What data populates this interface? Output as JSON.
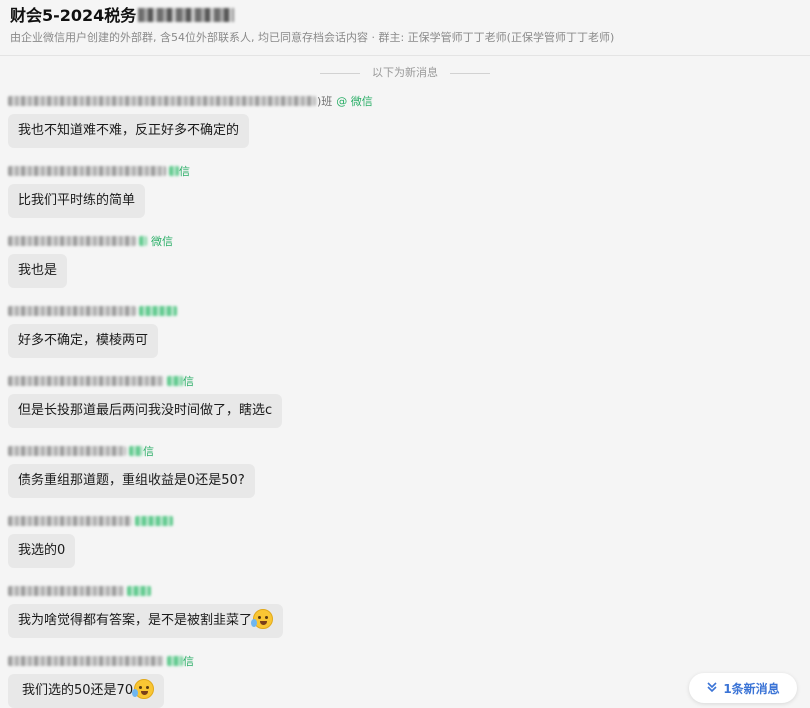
{
  "header": {
    "title": "财会5-2024税务",
    "subtitle": "由企业微信用户创建的外部群, 含54位外部联系人, 均已同意存档会话内容  · 群主: 正保学管师丁丁老师(正保学管师丁丁老师)"
  },
  "divider": {
    "label": "以下为新消息"
  },
  "messages": [
    {
      "sender_suffix": ")班",
      "at_source": "@ 微信",
      "text": "我也不知道难不难，反正好多不确定的"
    },
    {
      "sender_suffix": "",
      "at_source": "信",
      "text": "比我们平时练的简单"
    },
    {
      "sender_suffix": "",
      "at_source": "微信",
      "text": "我也是"
    },
    {
      "sender_suffix": "",
      "at_source": "",
      "text": "好多不确定，模棱两可"
    },
    {
      "sender_suffix": "",
      "at_source": "信",
      "text": "但是长投那道最后两问我没时间做了，瞎选c"
    },
    {
      "sender_suffix": "",
      "at_source": "信",
      "text": "债务重组那道题，重组收益是0还是50?"
    },
    {
      "sender_suffix": "",
      "at_source": "",
      "text": "我选的0"
    },
    {
      "sender_suffix": "",
      "at_source": "",
      "text": "我为啥觉得都有答案，是不是被割韭菜了"
    },
    {
      "sender_suffix": "",
      "at_source": "信",
      "text": "我们选的50还是70"
    }
  ],
  "new_message_button": {
    "label": "1条新消息",
    "icon": "double-chevron-down-icon"
  },
  "colors": {
    "background": "#f5f5f5",
    "bubble": "#e8e8e8",
    "source_green": "#2aae67",
    "link_blue": "#3b74d6"
  }
}
